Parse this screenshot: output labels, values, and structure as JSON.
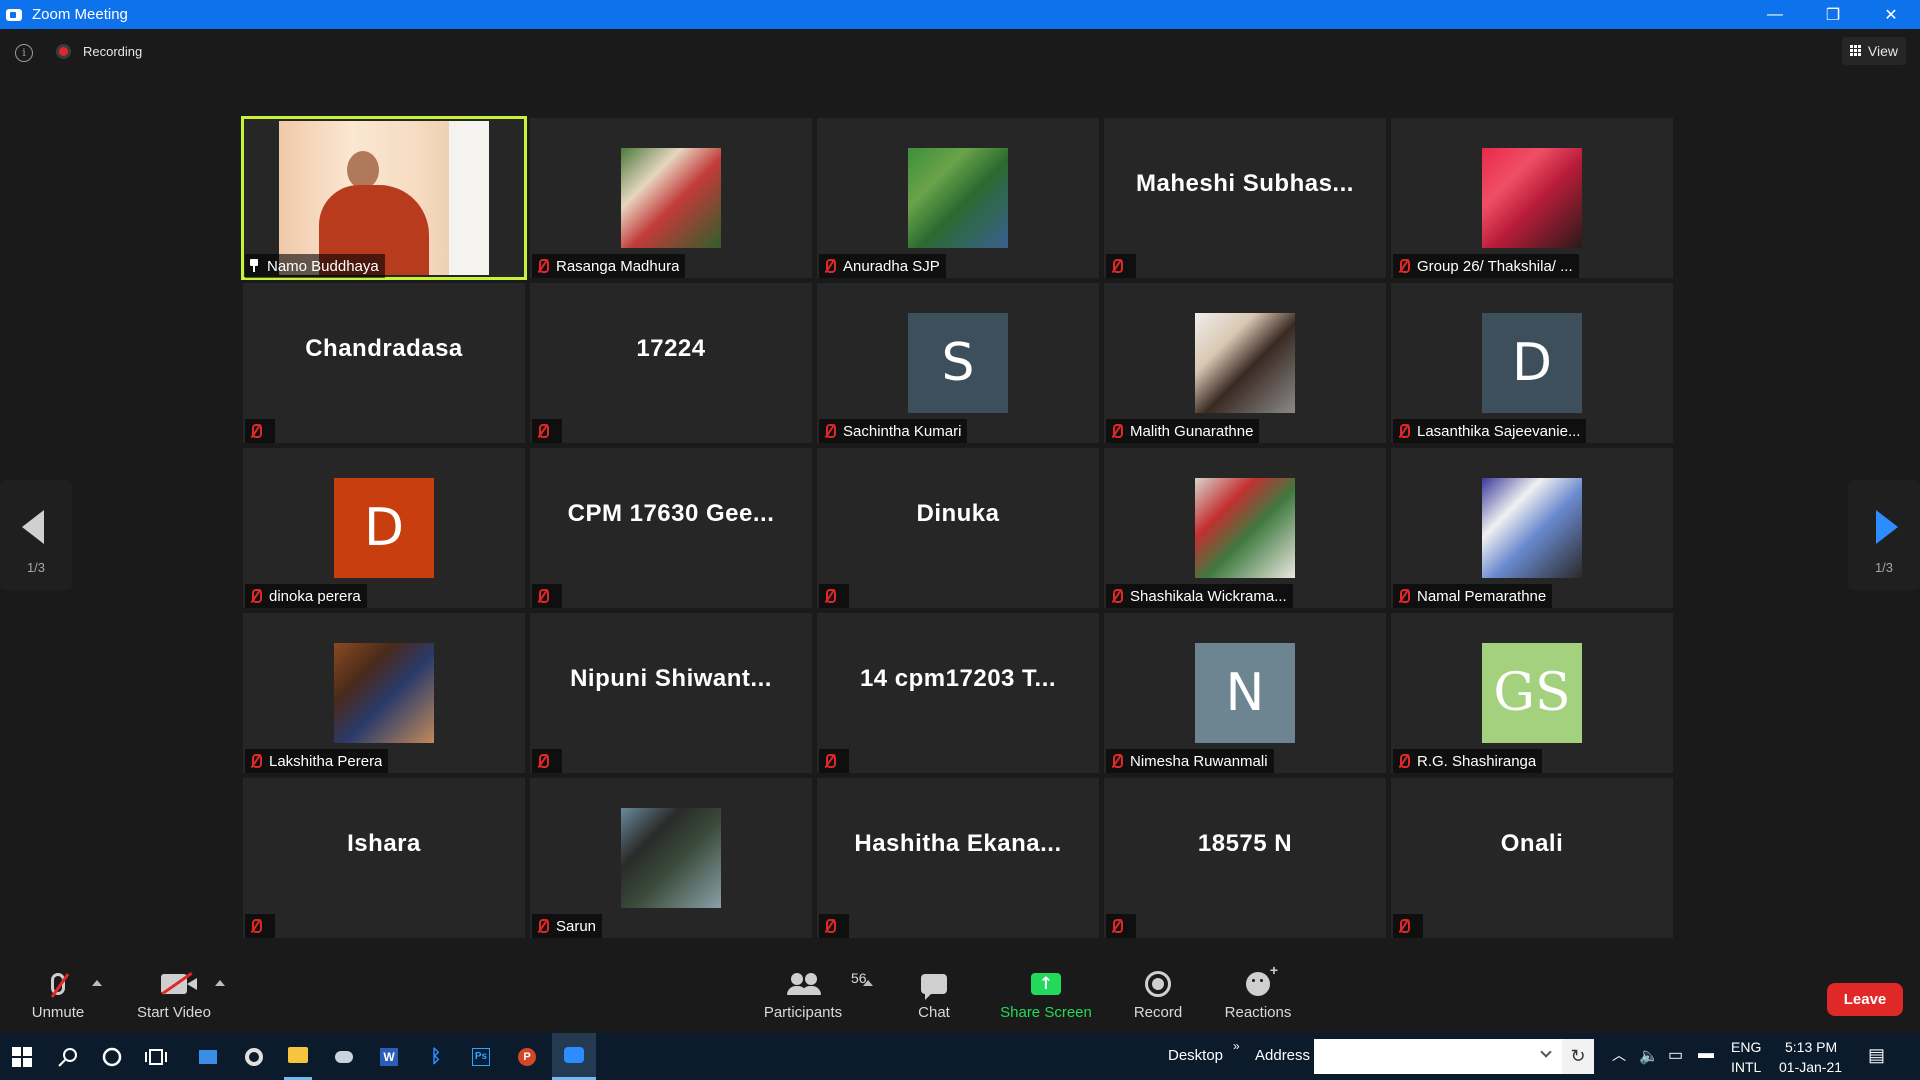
{
  "window": {
    "title": "Zoom Meeting"
  },
  "topbar": {
    "recording_label": "Recording",
    "view_label": "View"
  },
  "pagination": {
    "left": "1/3",
    "right": "1/3"
  },
  "tiles": [
    {
      "name": "Namo Buddhaya",
      "type": "video",
      "pinned": true,
      "active": true
    },
    {
      "name": "Rasanga Madhura",
      "type": "photo",
      "colors": [
        "#4a7a3a",
        "#c23a3a",
        "#2f5f2a",
        "#e6d6c0"
      ]
    },
    {
      "name": "Anuradha SJP",
      "type": "photo",
      "colors": [
        "#3e8f3a",
        "#2a6a2f",
        "#3a5f8f",
        "#6aa34a"
      ]
    },
    {
      "name": "",
      "big": "Maheshi  Subhas...",
      "type": "text"
    },
    {
      "name": "Group 26/ Thakshila/ ...",
      "type": "photo",
      "colors": [
        "#e8294a",
        "#b81c38",
        "#2a1a1a",
        "#f04f66"
      ]
    },
    {
      "name": "",
      "big": "Chandradasa",
      "type": "text"
    },
    {
      "name": "",
      "big": "17224",
      "type": "text"
    },
    {
      "name": "Sachintha Kumari",
      "type": "letter",
      "letter": "S",
      "bg": "#3e4f5c"
    },
    {
      "name": "Malith Gunarathne",
      "type": "photo",
      "colors": [
        "#f0eeea",
        "#3a2a22",
        "#8a8a8a",
        "#d9c7b3"
      ]
    },
    {
      "name": "Lasanthika Sajeevanie...",
      "type": "letter",
      "letter": "D",
      "bg": "#3e4f5c"
    },
    {
      "name": "dinoka perera",
      "type": "letter",
      "letter": "D",
      "bg": "#c93e0e"
    },
    {
      "name": "",
      "big": "CPM 17630 Gee...",
      "type": "text"
    },
    {
      "name": "",
      "big": "Dinuka",
      "type": "text"
    },
    {
      "name": "Shashikala Wickrama...",
      "type": "photo",
      "colors": [
        "#d8d4cc",
        "#3f7a3f",
        "#eae6df",
        "#c23030"
      ]
    },
    {
      "name": "Namal Pemarathne",
      "type": "photo",
      "colors": [
        "#3a3a9a",
        "#6a8ad0",
        "#2a2a2a",
        "#f0f0f0"
      ]
    },
    {
      "name": "Lakshitha Perera",
      "type": "photo",
      "colors": [
        "#8a4a22",
        "#2a3a6a",
        "#c28a5a",
        "#4a2a1a"
      ]
    },
    {
      "name": "",
      "big": "Nipuni  Shiwant...",
      "type": "text"
    },
    {
      "name": "",
      "big": "14 cpm17203  T...",
      "type": "text"
    },
    {
      "name": "Nimesha Ruwanmali",
      "type": "letter",
      "letter": "N",
      "bg": "#6d8591"
    },
    {
      "name": "R.G. Shashiranga",
      "type": "letter",
      "letter": "GS",
      "bg": "#a3d17d",
      "serif": true
    },
    {
      "name": "",
      "big": "Ishara",
      "type": "text"
    },
    {
      "name": "Sarun",
      "type": "photo",
      "colors": [
        "#6a8a9a",
        "#3a4a3a",
        "#8aa0a8",
        "#2a2a2a"
      ]
    },
    {
      "name": "",
      "big": "Hashitha  Ekana...",
      "type": "text"
    },
    {
      "name": "",
      "big": "18575 N",
      "type": "text"
    },
    {
      "name": "",
      "big": "Onali",
      "type": "text"
    }
  ],
  "toolbar": {
    "unmute": "Unmute",
    "start_video": "Start Video",
    "participants": "Participants",
    "participants_count": "56",
    "chat": "Chat",
    "share_screen": "Share Screen",
    "record": "Record",
    "reactions": "Reactions",
    "leave": "Leave"
  },
  "taskbar": {
    "desktop": "Desktop",
    "address": "Address",
    "lang_top": "ENG",
    "lang_bottom": "INTL",
    "time": "5:13 PM",
    "date": "01-Jan-21"
  },
  "colors": {
    "accent": "#0e72ed",
    "share": "#23d959",
    "leave": "#e02828",
    "active_border": "#c6f33a"
  }
}
